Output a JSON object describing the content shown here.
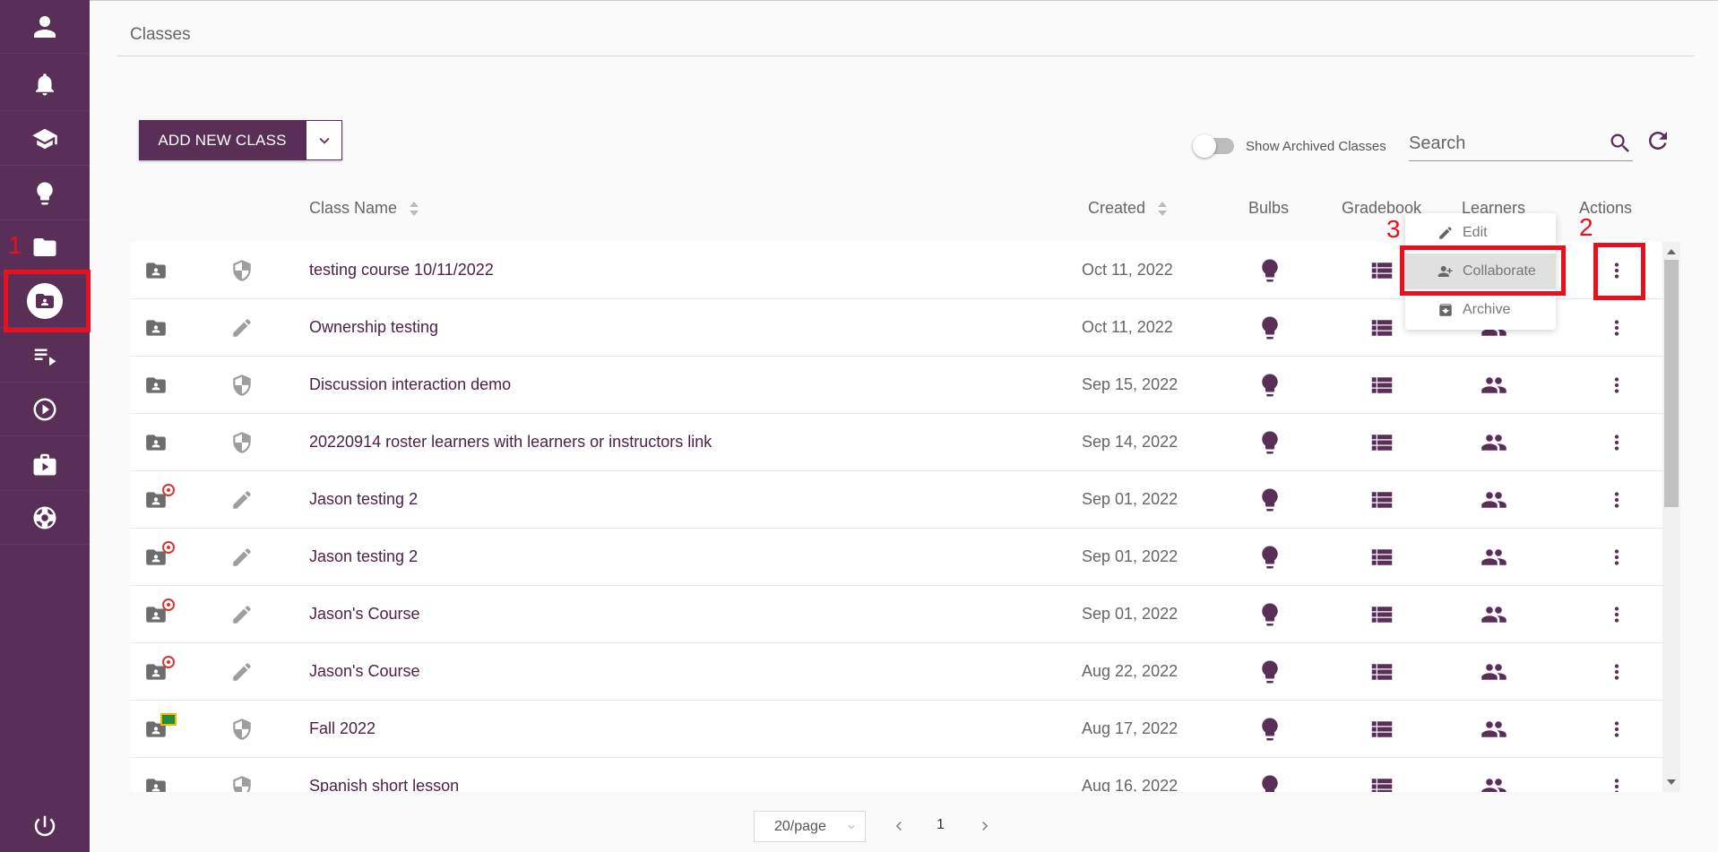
{
  "page": {
    "title": "Classes"
  },
  "toolbar": {
    "add_label": "ADD NEW CLASS",
    "archived_toggle_label": "Show Archived Classes",
    "search_placeholder": "Search"
  },
  "sidebar": {
    "items": [
      {
        "icon": "user-icon"
      },
      {
        "icon": "bell-icon"
      },
      {
        "icon": "graduation-cap-icon"
      },
      {
        "icon": "lightbulb-icon"
      },
      {
        "icon": "folder-icon"
      },
      {
        "icon": "folder-shared-icon",
        "active": true
      },
      {
        "icon": "playlist-icon"
      },
      {
        "icon": "play-circle-icon"
      },
      {
        "icon": "briefcase-play-icon"
      },
      {
        "icon": "lifebuoy-icon"
      }
    ],
    "bottom_icon": "power-icon"
  },
  "table": {
    "headers": {
      "name": "Class Name",
      "created": "Created",
      "bulbs": "Bulbs",
      "gradebook": "Gradebook",
      "learners": "Learners",
      "actions": "Actions"
    },
    "rows": [
      {
        "name": "testing course 10/11/2022",
        "created": "Oct 11, 2022",
        "status": "shield-icon",
        "badge": "none"
      },
      {
        "name": "Ownership testing",
        "created": "Oct 11, 2022",
        "status": "pencil-icon",
        "badge": "none"
      },
      {
        "name": "Discussion interaction demo",
        "created": "Sep 15, 2022",
        "status": "shield-icon",
        "badge": "none"
      },
      {
        "name": "20220914 roster learners with learners or instructors link",
        "created": "Sep 14, 2022",
        "status": "shield-icon",
        "badge": "none"
      },
      {
        "name": "Jason testing 2",
        "created": "Sep 01, 2022",
        "status": "pencil-icon",
        "badge": "lti"
      },
      {
        "name": "Jason testing 2",
        "created": "Sep 01, 2022",
        "status": "pencil-icon",
        "badge": "lti"
      },
      {
        "name": "Jason's Course",
        "created": "Sep 01, 2022",
        "status": "pencil-icon",
        "badge": "lti"
      },
      {
        "name": "Jason's Course",
        "created": "Aug 22, 2022",
        "status": "pencil-icon",
        "badge": "lti"
      },
      {
        "name": "Fall 2022",
        "created": "Aug 17, 2022",
        "status": "shield-icon",
        "badge": "classroom"
      },
      {
        "name": "Spanish short lesson",
        "created": "Aug 16, 2022",
        "status": "shield-icon",
        "badge": "none"
      }
    ]
  },
  "action_menu": {
    "items": [
      {
        "label": "Edit",
        "icon": "pencil-icon"
      },
      {
        "label": "Collaborate",
        "icon": "person-add-icon",
        "highlighted": true
      },
      {
        "label": "Archive",
        "icon": "archive-icon"
      }
    ]
  },
  "annotations": [
    "1",
    "2",
    "3"
  ],
  "pagination": {
    "page_size": "20/page",
    "current_page": "1"
  },
  "colors": {
    "brand": "#5a2f57",
    "annotation": "#e8101c"
  }
}
